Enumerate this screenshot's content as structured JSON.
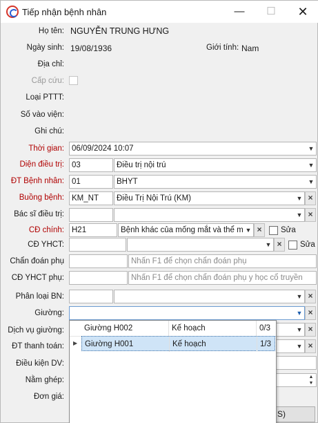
{
  "window": {
    "title": "Tiếp nhận bệnh nhân",
    "minimize": "—",
    "maximize": "☐",
    "close": "✕"
  },
  "labels": {
    "ho_ten": "Họ tên:",
    "ngay_sinh": "Ngày sinh:",
    "gioi_tinh": "Giới tính:",
    "dia_chi": "Địa chỉ:",
    "cap_cuu": "Cấp cứu:",
    "loai_pttt": "Loại PTTT:",
    "so_vao_vien": "Số vào viện:",
    "ghi_chu": "Ghi chú:",
    "thoi_gian": "Thời gian:",
    "dien_dieu_tri": "Diện điều trị:",
    "dt_benh_nhan": "ĐT Bệnh nhân:",
    "buong_benh": "Buồng bệnh:",
    "bac_si": "Bác sĩ điều trị:",
    "cd_chinh": "CĐ chính:",
    "cd_yhct": "CĐ YHCT:",
    "chan_doan_phu": "Chẩn đoán phụ",
    "cd_yhct_phu": "CĐ YHCT phụ:",
    "phan_loai_bn": "Phân loại BN:",
    "giuong": "Giường:",
    "dich_vu_giuong": "Dịch vụ giường:",
    "dt_thanh_toan": "ĐT thanh toán:",
    "dieu_kien_dv": "Điều kiện DV:",
    "nam_ghep": "Nằm ghép:",
    "don_gia": "Đơn giá:"
  },
  "patient": {
    "ho_ten": "NGUYỄN TRUNG HƯNG",
    "ngay_sinh": "19/08/1936",
    "gioi_tinh": "Nam"
  },
  "fields": {
    "thoi_gian": "06/09/2024 10:07",
    "dien_dieu_tri_code": "03",
    "dien_dieu_tri_name": "Điều trị nội trú",
    "dt_benh_nhan_code": "01",
    "dt_benh_nhan_name": "BHYT",
    "buong_benh_code": "KM_NT",
    "buong_benh_name": "Điều Trị Nội Trú (KM)",
    "cd_chinh_code": "H21",
    "cd_chinh_name": "Bệnh khác của mống mắt và thể mi",
    "chan_doan_phu_placeholder": "Nhấn F1 để chọn chẩn đoán phụ",
    "cd_yhct_phu_placeholder": "Nhấn F1 để chọn chẩn đoán phụ y học cổ truyền",
    "sua_label": "Sửa"
  },
  "bed_popup": {
    "rows": [
      {
        "name": "Giường H002",
        "plan": "Kế hoạch",
        "count": "0/3"
      },
      {
        "name": "Giường H001",
        "plan": "Kế hoạch",
        "count": "1/3"
      }
    ]
  },
  "bottom_button": "S)"
}
